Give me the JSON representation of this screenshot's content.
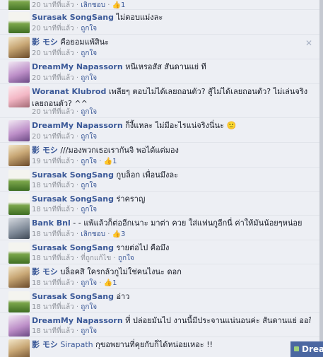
{
  "comments": [
    {
      "name": "",
      "text": "",
      "time": "20 นาทีที่แล้ว",
      "action": "เลิกชอบ",
      "likes": "1",
      "avatar": "green"
    },
    {
      "name": "Surasak SongSang",
      "text": "ไม่ตอบแม่งละ",
      "time": "20 นาทีที่แล้ว",
      "action": "ถูกใจ",
      "likes": "",
      "avatar": "green"
    },
    {
      "name": "影 モシ",
      "text": "คือยอมแพ้สินะ",
      "time": "20 นาทีที่แล้ว",
      "action": "ถูกใจ",
      "likes": "",
      "avatar": "boy"
    },
    {
      "name": "DreamMy Napassorn",
      "text": "หนีเหรอสัส สันดานแย่ ที",
      "time": "20 นาทีที่แล้ว",
      "action": "ถูกใจ",
      "likes": "",
      "avatar": "purple"
    },
    {
      "name": "Woranat Klubrod",
      "text": "เพลียๆ ตอบไม่ได้เลยถอนตัว? สู้ไม่ได้เลยถอนตัว? ไม่เล่นจริงเลยถอนตัว? ^^",
      "time": "20 นาทีที่แล้ว",
      "action": "ถูกใจ",
      "likes": "",
      "avatar": "pink"
    },
    {
      "name": "DreamMy Napassorn",
      "text": "ก็งี้แหละ ไม่มีอะไรแน่จริงนี่นะ 🙂",
      "time": "20 นาทีที่แล้ว",
      "action": "ถูกใจ",
      "likes": "",
      "avatar": "purple"
    },
    {
      "name": "影 モシ",
      "text": "///มองพวกเธอเรากันจิ พอได้แต่มอง",
      "time": "19 นาทีที่แล้ว",
      "action": "ถูกใจ",
      "likes": "1",
      "avatar": "boy"
    },
    {
      "name": "Surasak SongSang",
      "text": "กูบล็อก เพื่อนมึงละ",
      "time": "18 นาทีที่แล้ว",
      "action": "ถูกใจ",
      "likes": "",
      "avatar": "green"
    },
    {
      "name": "Surasak SongSang",
      "text": "ร่าคราญ",
      "time": "18 นาทีที่แล้ว",
      "action": "ถูกใจ",
      "likes": "",
      "avatar": "green"
    },
    {
      "name": "Bank Bnl",
      "text": "- - แพ้แล้วก็ต่ออีกเนาะ มาต่า ควย ใส่แฟนกูอีกนี่ ค่าให้มันน้อยๆหน่อย",
      "time": "18 นาทีที่แล้ว",
      "action": "เลิกชอบ",
      "likes": "3",
      "avatar": "gray"
    },
    {
      "name": "Surasak SongSang",
      "text": "รายต่อไป คือมึง",
      "time": "18 นาทีที่แล้ว",
      "action": "ที่ถูกแก้ไข",
      "action2": "ถูกใจ",
      "likes": "",
      "avatar": "green"
    },
    {
      "name": "影 モシ",
      "text": "บล็อคสิ ใครกล้วกูไม่ใช่คนไงนะ ดอก",
      "time": "18 นาทีที่แล้ว",
      "action": "ถูกใจ",
      "likes": "1",
      "avatar": "boy"
    },
    {
      "name": "Surasak SongSang",
      "text": "อ่าว",
      "time": "18 นาทีที่แล้ว",
      "action": "ถูกใจ",
      "likes": "",
      "avatar": "green"
    },
    {
      "name": "DreamMy Napassorn",
      "text": "ที่ ปล่อยมันไป งานนี้มีประจานแน่นอนค่ะ สันดานแย่ ออกีสติก !!",
      "time": "18 นาทีที่แล้ว",
      "action": "ถูกใจ",
      "likes": "",
      "avatar": "purple"
    },
    {
      "name": "影 モシ",
      "mention": "Sirapath",
      "text": "กุขอพยานที่คุยกับก็ได้หน่อยเหอะ !!",
      "time": "",
      "action": "",
      "likes": "",
      "avatar": "boy"
    }
  ],
  "chat_label": "Dream",
  "icons": {
    "close": "close-icon",
    "like": "thumbs-up-icon",
    "online": "online-dot-icon"
  },
  "colors": {
    "name": "#3b5998",
    "bg": "#edeff4",
    "meta": "#90949c",
    "chatbar": "#4b67a1"
  }
}
